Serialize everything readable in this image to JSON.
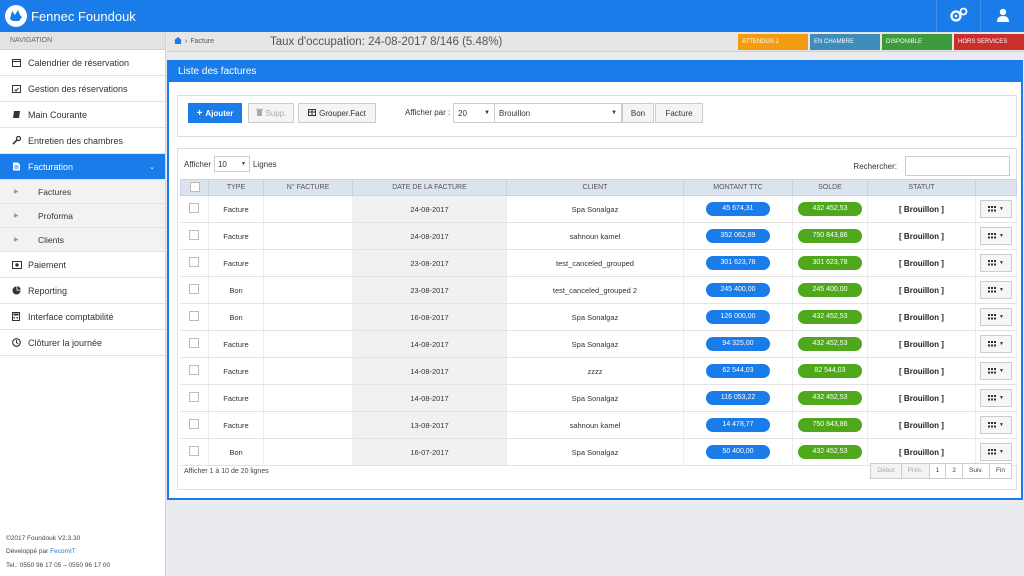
{
  "app": {
    "title": "Fennec Foundouk"
  },
  "sidebar": {
    "header": "NAVIGATION",
    "items": [
      {
        "label": "Calendrier de réservation",
        "icon": "calendar-icon"
      },
      {
        "label": "Gestion des réservations",
        "icon": "calendar-check-icon"
      },
      {
        "label": "Main Courante",
        "icon": "book-icon"
      },
      {
        "label": "Entretien des chambres",
        "icon": "wrench-icon"
      },
      {
        "label": "Facturation",
        "icon": "invoice-icon"
      }
    ],
    "subitems": [
      {
        "label": "Factures"
      },
      {
        "label": "Proforma"
      },
      {
        "label": "Clients"
      }
    ],
    "items_after": [
      {
        "label": "Paiement",
        "icon": "money-icon"
      },
      {
        "label": "Reporting",
        "icon": "pie-chart-icon"
      },
      {
        "label": "Interface comptabilité",
        "icon": "calculator-icon"
      },
      {
        "label": "Clôturer la journée",
        "icon": "clock-icon"
      }
    ],
    "footer": {
      "copyright": "©2017 Foundouk V2.3.30",
      "dev_prefix": "Développé par ",
      "dev_name": "FecomIT",
      "tel": "Tel.: 0550 96 17 05 – 0550 96 17 00"
    }
  },
  "breadcrumb": {
    "page": "Facture"
  },
  "occupancy": "Taux d'occupation: 24-08-2017  8/146 (5.48%)",
  "legend": [
    {
      "label": "ATTENDUS J",
      "color": "#f39c12"
    },
    {
      "label": "EN CHAMBRE",
      "color": "#3c8dbc"
    },
    {
      "label": "DISPONIBLE",
      "color": "#3d9a3d"
    },
    {
      "label": "HORS SERVICES",
      "color": "#c9302c"
    }
  ],
  "panel": {
    "title": "Liste des factures"
  },
  "toolbar": {
    "add_label": "Ajouter",
    "delete_label": "Supp.",
    "group_label": "Grouper.Fact",
    "per_page_label": "Afficher par :",
    "per_page_value": "20",
    "status_value": "Brouillon",
    "bon_label": "Bon",
    "facture_label": "Facture"
  },
  "table": {
    "show_label": "Afficher",
    "show_value": "10",
    "lines_label": "Lignes",
    "search_label": "Rechercher:",
    "search_value": "",
    "headers": [
      "TYPE",
      "N° FACTURE",
      "DATE DE LA FACTURE",
      "CLIENT",
      "MONTANT TTC",
      "SOLDE",
      "STATUT"
    ],
    "rows": [
      {
        "type": "Facture",
        "num": "",
        "date": "24-08-2017",
        "client": "Spa Sonalgaz",
        "montant": "45 674,31",
        "solde": "432 452,53",
        "statut": "[ Brouillon ]"
      },
      {
        "type": "Facture",
        "num": "",
        "date": "24-08-2017",
        "client": "sahnoun kamel",
        "montant": "352 062,89",
        "solde": "750 843,86",
        "statut": "[ Brouillon ]"
      },
      {
        "type": "Facture",
        "num": "",
        "date": "23-08-2017",
        "client": "test_canceled_grouped",
        "montant": "301 623,78",
        "solde": "301 623,78",
        "statut": "[ Brouillon ]"
      },
      {
        "type": "Bon",
        "num": "",
        "date": "23-08-2017",
        "client": "test_canceled_grouped 2",
        "montant": "245 400,00",
        "solde": "245 400,00",
        "statut": "[ Brouillon ]"
      },
      {
        "type": "Bon",
        "num": "",
        "date": "16-08-2017",
        "client": "Spa Sonalgaz",
        "montant": "126 000,00",
        "solde": "432 452,53",
        "statut": "[ Brouillon ]"
      },
      {
        "type": "Facture",
        "num": "",
        "date": "14-08-2017",
        "client": "Spa Sonalgaz",
        "montant": "94 325,00",
        "solde": "432 452,53",
        "statut": "[ Brouillon ]"
      },
      {
        "type": "Facture",
        "num": "",
        "date": "14-08-2017",
        "client": "zzzz",
        "montant": "62 544,03",
        "solde": "82 544,03",
        "statut": "[ Brouillon ]"
      },
      {
        "type": "Facture",
        "num": "",
        "date": "14-08-2017",
        "client": "Spa Sonalgaz",
        "montant": "116 053,22",
        "solde": "432 452,53",
        "statut": "[ Brouillon ]"
      },
      {
        "type": "Facture",
        "num": "",
        "date": "13-08-2017",
        "client": "sahnoun kamel",
        "montant": "14 478,77",
        "solde": "750 843,86",
        "statut": "[ Brouillon ]"
      },
      {
        "type": "Bon",
        "num": "",
        "date": "16-07-2017",
        "client": "Spa Sonalgaz",
        "montant": "50 400,00",
        "solde": "432 452,53",
        "statut": "[ Brouillon ]"
      }
    ],
    "info": "Afficher 1 à 10 de 20 lignes"
  },
  "pagination": {
    "first": "Début",
    "prev": "Préc.",
    "pages": [
      "1",
      "2"
    ],
    "next": "Suiv.",
    "last": "Fin"
  },
  "colors": {
    "accent": "#1a7ce8",
    "solde_green": "#4fa81b"
  }
}
